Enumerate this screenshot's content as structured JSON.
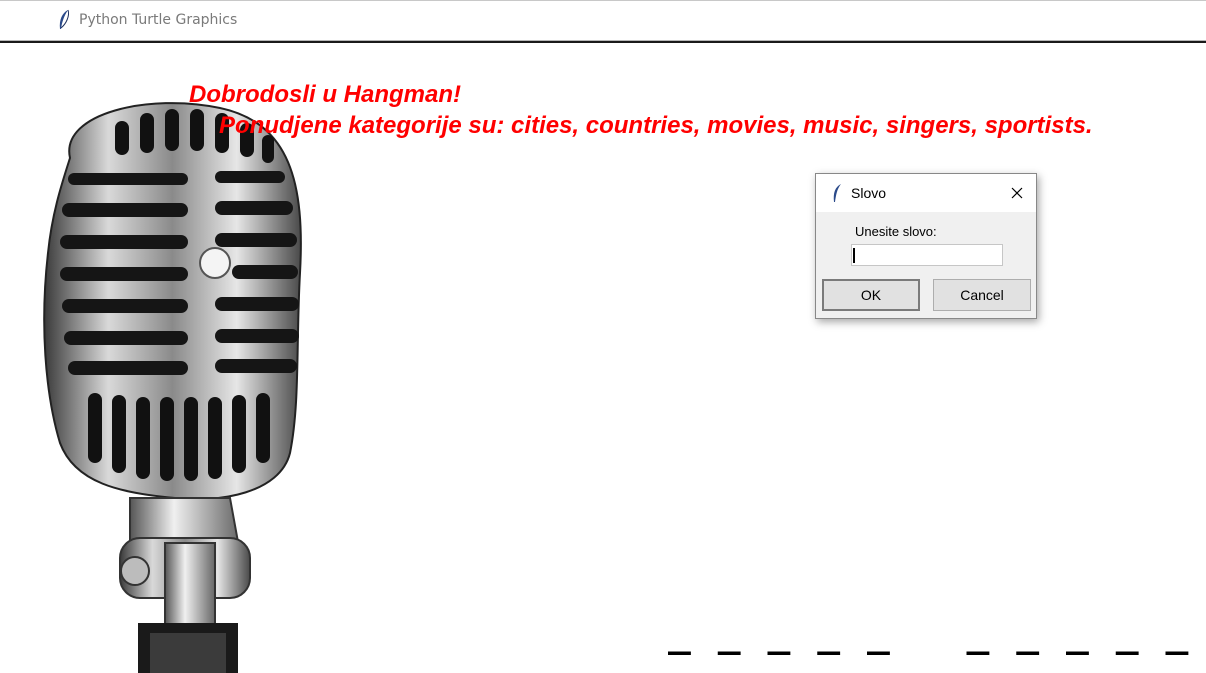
{
  "window": {
    "title": "Python Turtle Graphics",
    "icon": "feather-icon"
  },
  "canvas": {
    "headline_line1": "Dobrodosli u Hangman!",
    "headline_line2": "Ponudjene kategorije su: cities, countries, movies, music, singers, sportists.",
    "headline_color": "#ff0000",
    "word_blanks": "_ _ _ _ _   _ _ _ _ _ _ _ _",
    "image": "vintage-microphone"
  },
  "dialog": {
    "title": "Slovo",
    "icon": "feather-icon",
    "prompt": "Unesite slovo:",
    "input_value": "",
    "ok_label": "OK",
    "cancel_label": "Cancel",
    "close_icon": "close-icon"
  }
}
